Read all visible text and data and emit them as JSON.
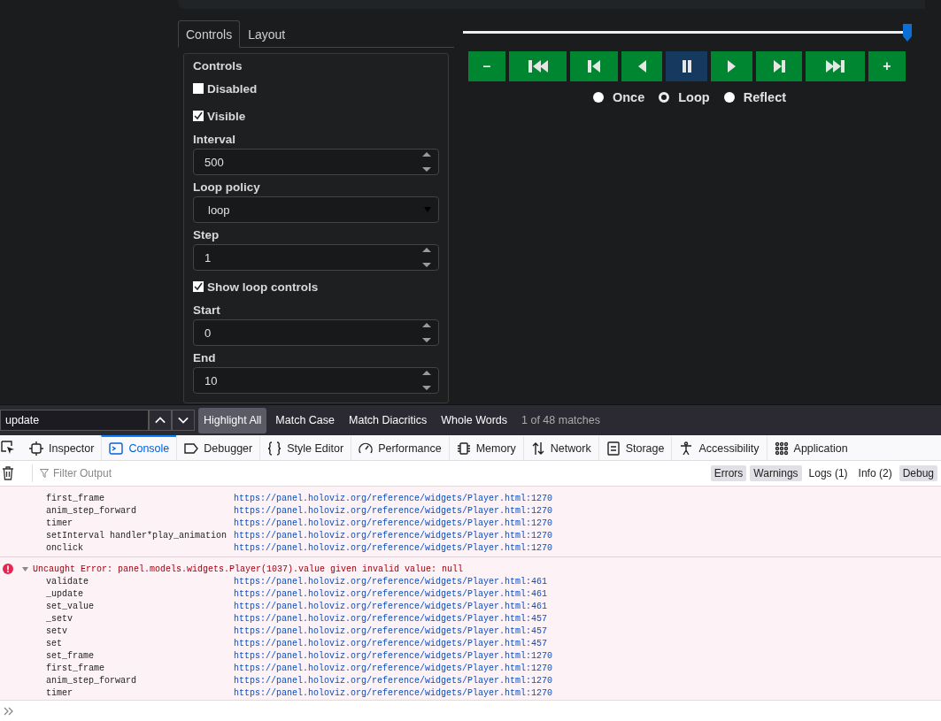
{
  "page": {
    "tabs": [
      {
        "label": "Controls",
        "selected": true
      },
      {
        "label": "Layout",
        "selected": false
      }
    ],
    "controls": {
      "title": "Controls",
      "items": [
        {
          "kind": "checkbox",
          "label": "Disabled",
          "checked": false
        },
        {
          "kind": "checkbox",
          "label": "Visible",
          "checked": true
        },
        {
          "kind": "number",
          "label": "Interval",
          "value": "500"
        },
        {
          "kind": "select",
          "label": "Loop policy",
          "value": "loop"
        },
        {
          "kind": "number",
          "label": "Step",
          "value": "1"
        },
        {
          "kind": "checkbox",
          "label": "Show loop controls",
          "checked": true
        },
        {
          "kind": "number",
          "label": "Start",
          "value": "0"
        },
        {
          "kind": "number",
          "label": "End",
          "value": "10"
        }
      ]
    },
    "player": {
      "level": 0.99,
      "buttons": [
        {
          "kind": "minus",
          "label": "–",
          "selected": false
        },
        {
          "kind": "first",
          "selected": false
        },
        {
          "kind": "previous",
          "selected": false
        },
        {
          "kind": "reverse",
          "selected": false
        },
        {
          "kind": "pause",
          "selected": true
        },
        {
          "kind": "play",
          "selected": false
        },
        {
          "kind": "next",
          "selected": false
        },
        {
          "kind": "last",
          "selected": false
        },
        {
          "kind": "plus",
          "label": "+",
          "selected": false
        }
      ],
      "loop_options": [
        {
          "label": "Once",
          "selected": false
        },
        {
          "label": "Loop",
          "selected": true
        },
        {
          "label": "Reflect",
          "selected": false
        }
      ]
    }
  },
  "find_bar": {
    "value": "update",
    "toggles": [
      {
        "label": "Highlight All",
        "on": true
      },
      {
        "label": "Match Case",
        "on": false
      },
      {
        "label": "Match Diacritics",
        "on": false
      },
      {
        "label": "Whole Words",
        "on": false
      }
    ],
    "status": "1 of 48 matches"
  },
  "devtools": {
    "tabs": [
      {
        "label": "Inspector",
        "selected": false
      },
      {
        "label": "Console",
        "selected": true
      },
      {
        "label": "Debugger",
        "selected": false
      },
      {
        "label": "Style Editor",
        "selected": false
      },
      {
        "label": "Performance",
        "selected": false
      },
      {
        "label": "Memory",
        "selected": false
      },
      {
        "label": "Network",
        "selected": false
      },
      {
        "label": "Storage",
        "selected": false
      },
      {
        "label": "Accessibility",
        "selected": false
      },
      {
        "label": "Application",
        "selected": false
      }
    ],
    "filter": {
      "placeholder": "Filter Output",
      "levels": [
        {
          "label": "Errors",
          "on": true
        },
        {
          "label": "Warnings",
          "on": true
        },
        {
          "label": "Logs (1)",
          "on": false
        },
        {
          "label": "Info (2)",
          "on": false
        },
        {
          "label": "Debug",
          "on": true
        }
      ]
    },
    "console": {
      "groups": [
        {
          "kind": "trace",
          "frames": [
            {
              "function": "first_frame",
              "location": "https://panel.holoviz.org/reference/widgets/Player.html:1270"
            },
            {
              "function": "anim_step_forward",
              "location": "https://panel.holoviz.org/reference/widgets/Player.html:1270"
            },
            {
              "function": "timer",
              "location": "https://panel.holoviz.org/reference/widgets/Player.html:1270"
            },
            {
              "function": "setInterval handler*play_animation",
              "location": "https://panel.holoviz.org/reference/widgets/Player.html:1270"
            },
            {
              "function": "onclick",
              "location": "https://panel.holoviz.org/reference/widgets/Player.html:1270"
            }
          ]
        },
        {
          "kind": "error",
          "message": "Uncaught Error: panel.models.widgets.Player(1037).value given invalid value: null",
          "expanded": true,
          "frames": [
            {
              "function": "validate",
              "location": "https://panel.holoviz.org/reference/widgets/Player.html:461"
            },
            {
              "function": "_update",
              "location": "https://panel.holoviz.org/reference/widgets/Player.html:461"
            },
            {
              "function": "set_value",
              "location": "https://panel.holoviz.org/reference/widgets/Player.html:461"
            },
            {
              "function": "_setv",
              "location": "https://panel.holoviz.org/reference/widgets/Player.html:457"
            },
            {
              "function": "setv",
              "location": "https://panel.holoviz.org/reference/widgets/Player.html:457"
            },
            {
              "function": "set",
              "location": "https://panel.holoviz.org/reference/widgets/Player.html:457"
            },
            {
              "function": "set_frame",
              "location": "https://panel.holoviz.org/reference/widgets/Player.html:1270"
            },
            {
              "function": "first_frame",
              "location": "https://panel.holoviz.org/reference/widgets/Player.html:1270"
            },
            {
              "function": "anim_step_forward",
              "location": "https://panel.holoviz.org/reference/widgets/Player.html:1270"
            },
            {
              "function": "timer",
              "location": "https://panel.holoviz.org/reference/widgets/Player.html:1270"
            }
          ]
        }
      ]
    }
  }
}
